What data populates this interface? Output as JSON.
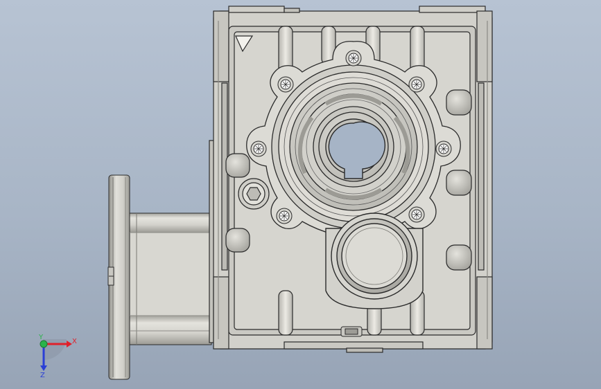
{
  "viewport": {
    "colors": {
      "background_top": "#b7c3d3",
      "background_bottom": "#97a4b6",
      "body_fill": "#d9d8d2",
      "body_shadow": "#a9a8a2",
      "edge": "#2a2a2a",
      "bore": "#a6b4c6"
    }
  },
  "triad": {
    "x_label": "X",
    "y_label": "Y",
    "z_label": "Z",
    "colors": {
      "x": "#e0202a",
      "y": "#2bb34a",
      "z": "#2a3fd6"
    }
  }
}
